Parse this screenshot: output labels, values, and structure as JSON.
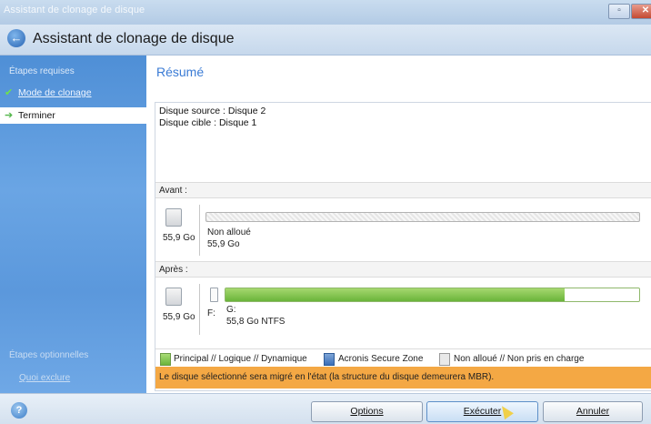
{
  "window": {
    "title": "Assistant de clonage de disque"
  },
  "header": {
    "title": "Assistant de clonage de disque"
  },
  "sidebar": {
    "required_steps_label": "Étapes requises",
    "items": [
      {
        "label": "Mode de clonage",
        "state": "done"
      },
      {
        "label": "Terminer",
        "state": "current"
      }
    ],
    "optional_steps_label": "Étapes optionnelles",
    "what_to_exclude": "Quoi exclure"
  },
  "main": {
    "title": "Résumé",
    "source_disk": "Disque source : Disque 2",
    "target_disk": "Disque cible : Disque 1",
    "before": {
      "label": "Avant :",
      "disk_size": "55,9 Go",
      "partition_name": "Non alloué",
      "partition_size": "55,9 Go"
    },
    "after": {
      "label": "Après :",
      "disk_size": "55,9 Go",
      "small_letter": "F:",
      "partition_letter": "G:",
      "partition_info": "55,8 Go  NTFS",
      "fill_fraction": 0.82
    },
    "legend": {
      "primary": "Principal // Logique // Dynamique",
      "acronis": "Acronis Secure Zone",
      "unallocated": "Non alloué // Non pris en charge"
    },
    "warning": "Le disque sélectionné sera migré en l'état (la structure du disque demeurera MBR)."
  },
  "footer": {
    "options": "Options",
    "execute": "Exécuter",
    "cancel": "Annuler"
  },
  "colors": {
    "accent": "#3a7bd5",
    "sidebar": "#5b98dc",
    "partition_fill": "#6ab43a",
    "warning": "#f4a844"
  }
}
